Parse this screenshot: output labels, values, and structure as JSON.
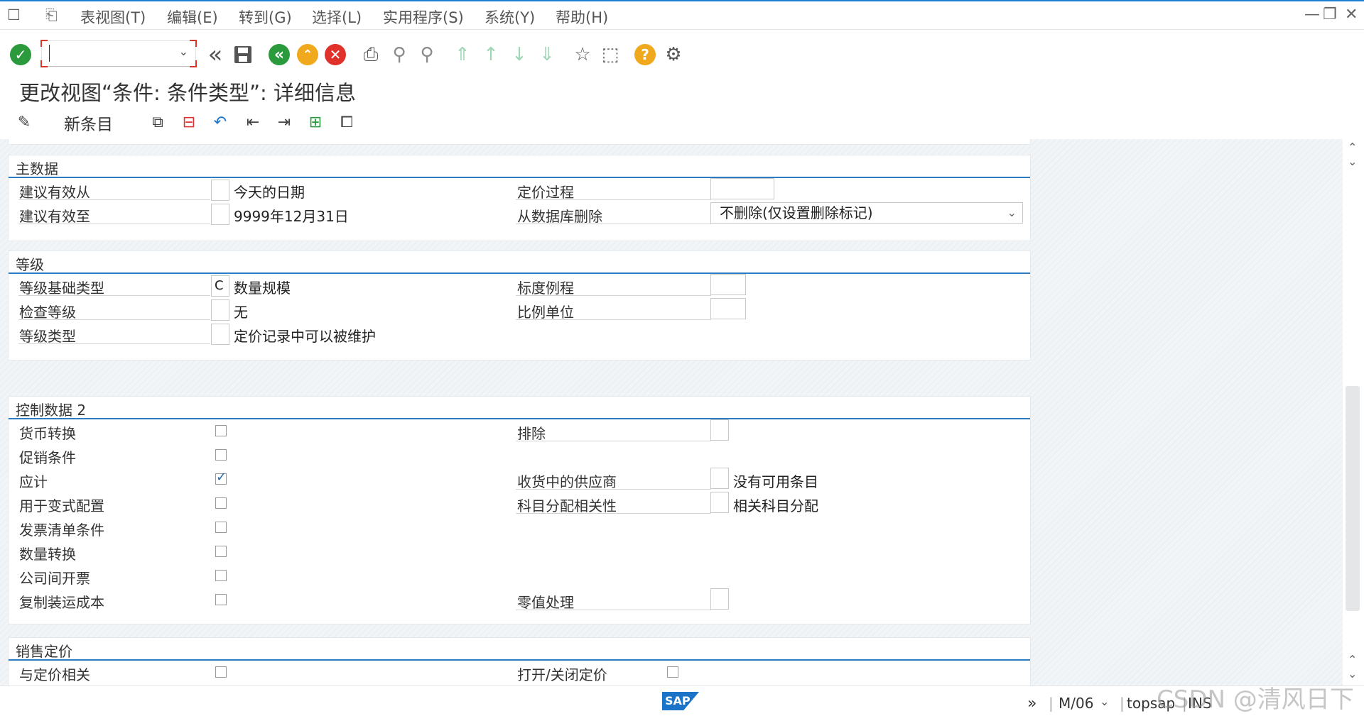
{
  "menubar": {
    "items": [
      "表视图(T)",
      "编辑(E)",
      "转到(G)",
      "选择(L)",
      "实用程序(S)",
      "系统(Y)",
      "帮助(H)"
    ]
  },
  "toolbar": {
    "command_field_value": "",
    "icons": [
      "enter-icon",
      "back-double-icon",
      "save-icon",
      "back-icon",
      "exit-icon",
      "cancel-icon",
      "print-icon",
      "find-icon",
      "find-next-icon",
      "first-page-icon",
      "previous-page-icon",
      "next-page-icon",
      "last-page-icon",
      "create-session-icon",
      "shortcut-icon",
      "help-icon",
      "customize-layout-icon"
    ]
  },
  "screen": {
    "title": "更改视图“条件: 条件类型”: 详细信息"
  },
  "app_toolbar": {
    "new_entries_label": "新条目"
  },
  "groups": {
    "master_data": {
      "title": "主数据",
      "valid_from_label": "建议有效从",
      "valid_from_code": "",
      "valid_from_text": "今天的日期",
      "valid_to_label": "建议有效至",
      "valid_to_code": "",
      "valid_to_text": "9999年12月31日",
      "pricing_procedure_label": "定价过程",
      "pricing_procedure_value": "",
      "delete_label": "从数据库删除",
      "delete_value": "不删除(仅设置删除标记)"
    },
    "scales": {
      "title": "等级",
      "scale_base_label": "等级基础类型",
      "scale_base_code": "C",
      "scale_base_text": "数量规模",
      "check_scale_label": "检查等级",
      "check_scale_code": "",
      "check_scale_text": "无",
      "scale_type_label": "等级类型",
      "scale_type_code": "",
      "scale_type_text": "定价记录中可以被维护",
      "scale_formula_label": "标度例程",
      "scale_formula_value": "",
      "unit_label": "比例单位",
      "unit_value": ""
    },
    "control_data_2": {
      "title": "控制数据 2",
      "left_items": [
        {
          "label": "货币转换",
          "checked": false
        },
        {
          "label": "促销条件",
          "checked": false
        },
        {
          "label": "应计",
          "checked": true
        },
        {
          "label": "用于变式配置",
          "checked": false
        },
        {
          "label": "发票清单条件",
          "checked": false
        },
        {
          "label": "数量转换",
          "checked": false
        },
        {
          "label": "公司间开票",
          "checked": false
        },
        {
          "label": "复制装运成本",
          "checked": false
        }
      ],
      "exclusion_label": "排除",
      "exclusion_value": "",
      "vendor_label": "收货中的供应商",
      "vendor_code": "",
      "vendor_text": "没有可用条目",
      "acct_label": "科目分配相关性",
      "acct_code": "",
      "acct_text": "相关科目分配",
      "zero_label": "零值处理",
      "zero_value": ""
    },
    "sales_pricing": {
      "title": "销售定价",
      "pricing_relevant_label": "与定价相关",
      "pricing_relevant_checked": false,
      "open_close_label": "打开/关闭定价",
      "open_close_checked": false
    }
  },
  "statusbar": {
    "logo_text": "SAP",
    "session": "M/06",
    "server": "topsap",
    "mode": "INS"
  },
  "watermark": "CSDN @清风日下",
  "colors": {
    "accent_line": "#2a7dc3",
    "enter_green": "#2a9a3c",
    "back_green": "#2a9a3c",
    "exit_orange": "#f0a81c",
    "cancel_red": "#e0322b",
    "help_orange": "#f0a81c"
  }
}
